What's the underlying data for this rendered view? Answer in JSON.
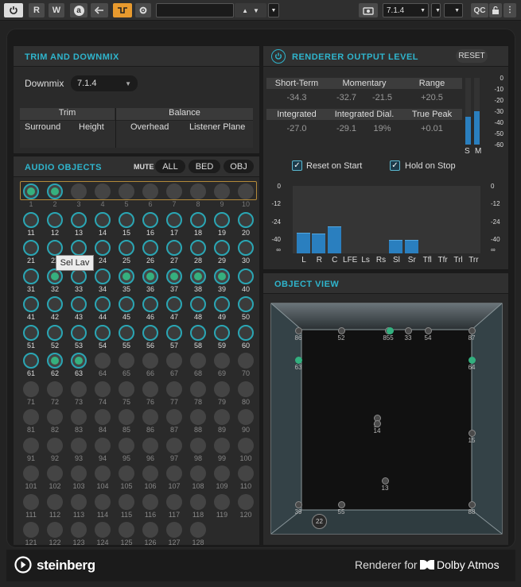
{
  "toolbar": {
    "r_label": "R",
    "w_label": "W",
    "a_label": "a",
    "preset_value": "",
    "format_value": "7.1.4",
    "qc_label": "QC"
  },
  "trim": {
    "title": "TRIM AND DOWNMIX",
    "downmix_label": "Downmix",
    "downmix_value": "7.1.4",
    "trim_header": "Trim",
    "balance_header": "Balance",
    "cols": [
      "Surround",
      "Height",
      "Overhead",
      "Listener Plane"
    ]
  },
  "objects": {
    "title": "AUDIO OBJECTS",
    "mute_label": "MUTE",
    "all_label": "ALL",
    "bed_label": "BED",
    "obj_label": "OBJ",
    "tooltip": "Sel Lav",
    "numbers": [
      "1",
      "2",
      "3",
      "4",
      "5",
      "6",
      "7",
      "8",
      "9",
      "10",
      "11",
      "12",
      "13",
      "14",
      "15",
      "16",
      "17",
      "18",
      "19",
      "20",
      "21",
      "22",
      "23",
      "24",
      "25",
      "26",
      "27",
      "28",
      "29",
      "30",
      "31",
      "32",
      "33",
      "34",
      "35",
      "36",
      "37",
      "38",
      "39",
      "40",
      "41",
      "42",
      "43",
      "44",
      "45",
      "46",
      "47",
      "48",
      "49",
      "50",
      "51",
      "52",
      "53",
      "54",
      "55",
      "56",
      "57",
      "58",
      "59",
      "60",
      "61",
      "62",
      "63",
      "64",
      "65",
      "66",
      "67",
      "68",
      "69",
      "70",
      "71",
      "72",
      "73",
      "74",
      "75",
      "76",
      "77",
      "78",
      "79",
      "80",
      "81",
      "82",
      "83",
      "84",
      "85",
      "86",
      "87",
      "88",
      "89",
      "90",
      "91",
      "92",
      "93",
      "94",
      "95",
      "96",
      "97",
      "98",
      "99",
      "100",
      "101",
      "102",
      "103",
      "104",
      "105",
      "106",
      "107",
      "108",
      "109",
      "110",
      "111",
      "112",
      "113",
      "114",
      "115",
      "116",
      "117",
      "118",
      "119",
      "120",
      "121",
      "122",
      "123",
      "124",
      "125",
      "126",
      "127",
      "128"
    ]
  },
  "renderer": {
    "title": "RENDERER OUTPUT LEVEL",
    "reset_label": "RESET",
    "short_term_label": "Short-Term",
    "short_term_value": "-34.3",
    "momentary_label": "Momentary",
    "momentary_value": "-32.7",
    "momentary_value2": "-21.5",
    "range_label": "Range",
    "range_value": "+20.5",
    "integrated_label": "Integrated",
    "integrated_value": "-27.0",
    "dial_label": "Integrated Dial.",
    "dial_value": "-29.1",
    "dial_pct": "19%",
    "peak_label": "True Peak",
    "peak_value": "+0.01",
    "reset_start_label": "Reset on Start",
    "hold_stop_label": "Hold on Stop",
    "loud_scale": [
      "0",
      "-10",
      "-20",
      "-30",
      "-40",
      "-50",
      "-60"
    ],
    "sm_labels": [
      "S",
      "M"
    ],
    "sm_levels": [
      0.42,
      0.5
    ],
    "ch_scale": [
      "0",
      "-12",
      "-24",
      "-40",
      "∞"
    ],
    "channels": [
      "L",
      "R",
      "C",
      "LFE",
      "Ls",
      "Rs",
      "Sl",
      "Sr",
      "Tfl",
      "Tfr",
      "Trl",
      "Trr"
    ],
    "levels_db": [
      -31,
      -31.5,
      -27,
      null,
      null,
      null,
      -36,
      -36,
      null,
      null,
      null,
      null
    ]
  },
  "object_view": {
    "title": "OBJECT VIEW",
    "labels": [
      "86",
      "52",
      "855",
      "33",
      "54",
      "87",
      "63",
      "64",
      "97",
      "14",
      "15",
      "13",
      "39",
      "55",
      "88",
      "22"
    ]
  },
  "footer": {
    "brand": "steinberg",
    "product": "Renderer for",
    "dolby": "Dolby Atmos"
  }
}
